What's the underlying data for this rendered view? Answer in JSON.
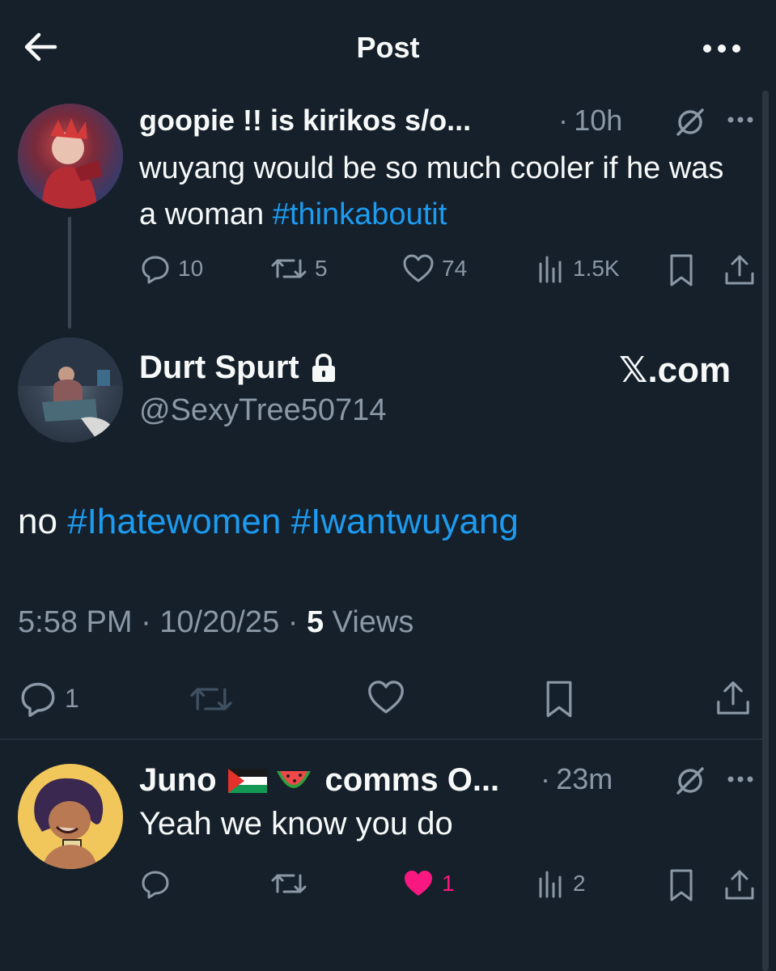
{
  "header": {
    "title": "Post",
    "back_icon": "arrow-left-icon",
    "more_icon": "more-horizontal-icon"
  },
  "parent_post": {
    "author_name": "goopie !! is kirikos s/o...",
    "time": "10h",
    "text_plain": "wuyang would be so much cooler if he was a woman",
    "hashtag": "#thinkaboutit",
    "stats": {
      "replies": "10",
      "reposts": "5",
      "likes": "74",
      "views": "1.5K"
    }
  },
  "main_post": {
    "author_name": "Durt Spurt",
    "handle": "@SexyTree50714",
    "source_label": "𝕏.com",
    "text_plain": "no",
    "hashtags": [
      "#Ihatewomen",
      "#Iwantwuyang"
    ],
    "meta_time": "5:58 PM · 10/20/25 · ",
    "meta_views_count": "5",
    "meta_views_label": " Views",
    "reply_count": "1"
  },
  "reply_post": {
    "author_name_part1": "Juno",
    "author_name_part2": "comms O...",
    "time": "23m",
    "text": "Yeah we know you do",
    "stats": {
      "likes": "1",
      "views": "2"
    }
  },
  "colors": {
    "background": "#15202b",
    "accent": "#1d9bf0",
    "muted": "#8b98a5",
    "like_active": "#f91880"
  }
}
